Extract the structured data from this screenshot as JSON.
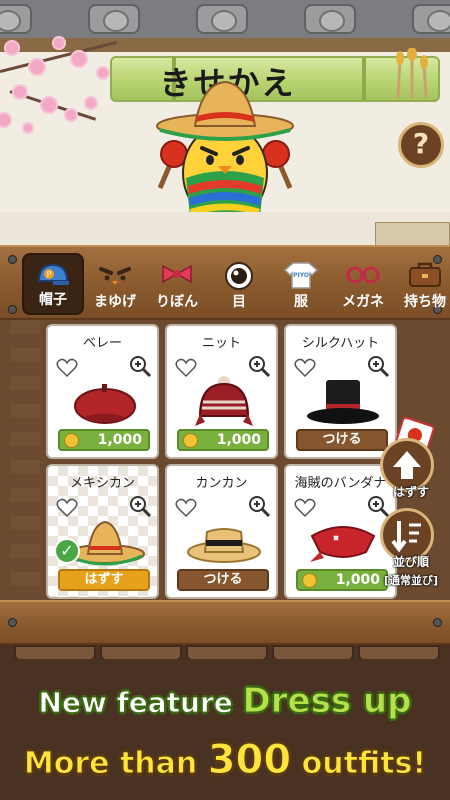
{
  "screen": {
    "title": "きせかえ",
    "help_label": "?"
  },
  "tabs": [
    {
      "label": "帽子",
      "icon": "cap-icon",
      "active": true
    },
    {
      "label": "まゆげ",
      "icon": "eyebrows-icon",
      "active": false
    },
    {
      "label": "りぼん",
      "icon": "ribbon-icon",
      "active": false
    },
    {
      "label": "目",
      "icon": "eye-icon",
      "active": false
    },
    {
      "label": "服",
      "icon": "shirt-icon",
      "active": false
    },
    {
      "label": "メガネ",
      "icon": "glasses-icon",
      "active": false
    },
    {
      "label": "持ち物",
      "icon": "bag-icon",
      "active": false
    }
  ],
  "tab_extra": {
    "shirt_text": "PIYO"
  },
  "items": [
    {
      "name": "ベレー",
      "price": "1,000",
      "state": "buy"
    },
    {
      "name": "ニット",
      "price": "1,000",
      "state": "buy"
    },
    {
      "name": "シルクハット",
      "action": "つける",
      "state": "owned"
    },
    {
      "name": "メキシカン",
      "action": "はずす",
      "state": "equipped"
    },
    {
      "name": "カンカン",
      "action": "つける",
      "state": "owned"
    },
    {
      "name": "海賊のバンダナ",
      "price": "1,000",
      "state": "buy"
    }
  ],
  "side_buttons": {
    "remove_label": "はずす",
    "sort_label": "並び順",
    "sort_mode": "[通常並び]"
  },
  "promo": {
    "line1_pre": "New feature ",
    "line1_highlight": "Dress up",
    "line2_pre": "More than ",
    "line2_number": "300",
    "line2_post": " outfits!"
  },
  "colors": {
    "buy_button": "#7ab03e",
    "action_button": "#86562e",
    "remove_button": "#e6a21d",
    "wood": "#8a5a2e"
  }
}
